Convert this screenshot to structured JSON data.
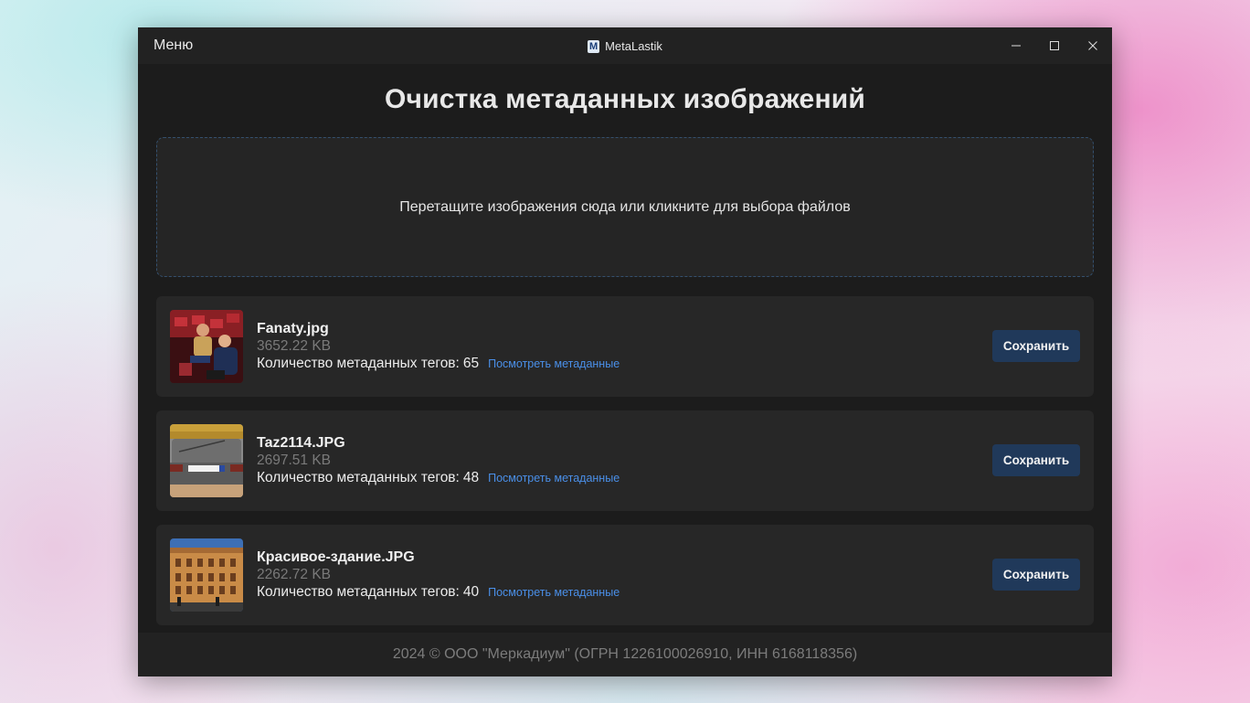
{
  "window": {
    "menu_label": "Меню",
    "app_title": "MetaLastik",
    "app_logo_letter": "M"
  },
  "main": {
    "title": "Очистка метаданных изображений",
    "dropzone_text": "Перетащите изображения сюда или кликните для выбора файлов"
  },
  "files": [
    {
      "name": "Fanaty.jpg",
      "size": "3652.22 KB",
      "meta_label": "Количество метаданных тегов:",
      "meta_count": "65",
      "view_link": "Посмотреть метаданные",
      "save_label": "Сохранить"
    },
    {
      "name": "Taz2114.JPG",
      "size": "2697.51 KB",
      "meta_label": "Количество метаданных тегов:",
      "meta_count": "48",
      "view_link": "Посмотреть метаданные",
      "save_label": "Сохранить"
    },
    {
      "name": "Красивое-здание.JPG",
      "size": "2262.72 KB",
      "meta_label": "Количество метаданных тегов:",
      "meta_count": "40",
      "view_link": "Посмотреть метаданные",
      "save_label": "Сохранить"
    }
  ],
  "footer": {
    "text": "2024 © ООО \"Меркадиум\" (ОГРН 1226100026910, ИНН 6168118356)"
  },
  "colors": {
    "window_bg": "#1c1c1c",
    "card_bg": "#272727",
    "accent_button": "#20395a",
    "link": "#4a8fe8"
  }
}
